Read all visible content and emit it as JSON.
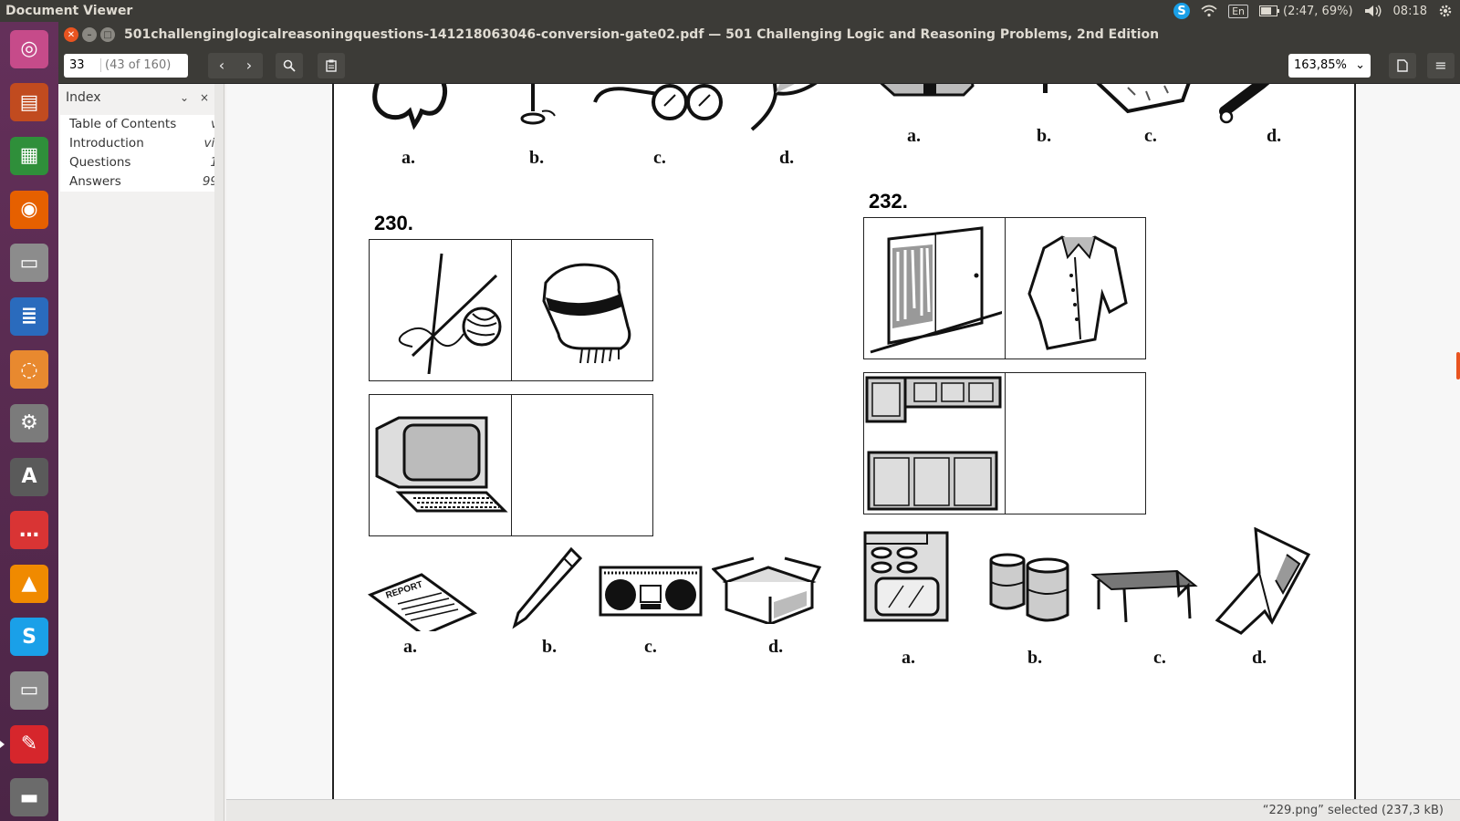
{
  "system": {
    "app_title": "Document Viewer",
    "input_lang": "En",
    "battery": "(2:47, 69%)",
    "clock": "08:18"
  },
  "launcher": {
    "items": [
      {
        "name": "ubuntu-dash-icon",
        "color": "#c64b8a"
      },
      {
        "name": "impress-icon",
        "color": "#c14b1f"
      },
      {
        "name": "calc-icon",
        "color": "#2f8f3a"
      },
      {
        "name": "firefox-icon",
        "color": "#e66000"
      },
      {
        "name": "files-icon",
        "color": "#8c8c8c"
      },
      {
        "name": "writer-icon",
        "color": "#2a6bbd"
      },
      {
        "name": "shotwell-icon",
        "color": "#e8892f"
      },
      {
        "name": "settings-icon",
        "color": "#7b7b7b"
      },
      {
        "name": "software-updater-icon",
        "color": "#5a5a5a"
      },
      {
        "name": "chat-icon",
        "color": "#d93434"
      },
      {
        "name": "vlc-icon",
        "color": "#f08a00"
      },
      {
        "name": "skype-icon",
        "color": "#1aa0e8"
      },
      {
        "name": "archive-icon",
        "color": "#8c8c8c"
      },
      {
        "name": "document-viewer-icon",
        "color": "#d6262c"
      },
      {
        "name": "scanner-icon",
        "color": "#6b6b6b"
      }
    ]
  },
  "window": {
    "title": "501challenginglogicalreasoningquestions-141218063046-conversion-gate02.pdf — 501 Challenging Logic and Reasoning Problems, 2nd Edition"
  },
  "toolbar": {
    "page_value": "33",
    "page_of": "(43 of 160)",
    "zoom": "163,85%"
  },
  "sidebar": {
    "title": "Index",
    "items": [
      {
        "label": "Table of Contents",
        "page": "v"
      },
      {
        "label": "Introduction",
        "page": "vii"
      },
      {
        "label": "Questions",
        "page": "1"
      },
      {
        "label": "Answers",
        "page": "99"
      }
    ]
  },
  "document": {
    "q230": "230.",
    "q232": "232.",
    "top_left_labels": [
      "a.",
      "b.",
      "c.",
      "d."
    ],
    "top_right_labels": [
      "a.",
      "b.",
      "c.",
      "d."
    ],
    "q230_labels": [
      "a.",
      "b.",
      "c.",
      "d."
    ],
    "q232_labels": [
      "a.",
      "b.",
      "c.",
      "d."
    ],
    "report_word": "REPORT"
  },
  "status": {
    "text": "“229.png” selected  (237,3 kB)"
  }
}
